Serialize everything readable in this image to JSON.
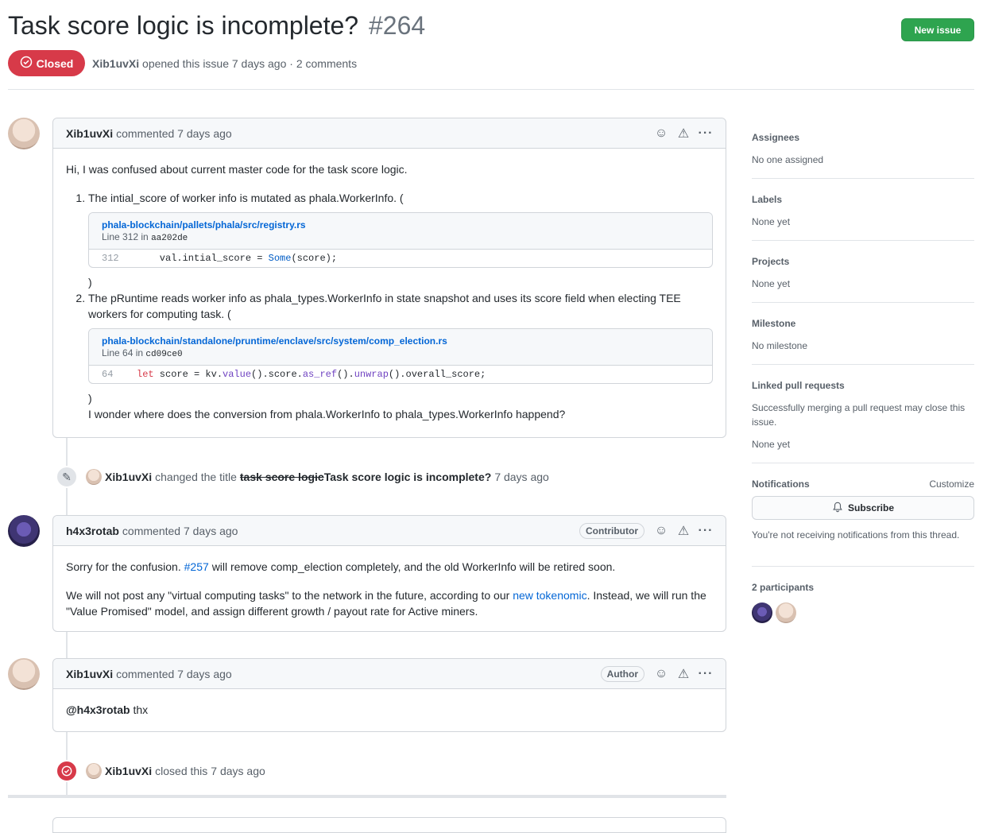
{
  "issue": {
    "title": "Task score logic is incomplete?",
    "number": "#264",
    "state": "Closed",
    "author": "Xib1uvXi",
    "opened_text": "opened this issue 7 days ago · 2 comments",
    "new_issue_label": "New issue"
  },
  "comment1": {
    "author": "Xib1uvXi",
    "time": "commented 7 days ago",
    "intro": "Hi, I was confused about current master code for the task score logic.",
    "item1_text": "The intial_score of worker info is mutated as phala.WorkerInfo. (",
    "item1_close": ")",
    "code1": {
      "path": "phala-blockchain/pallets/phala/src/registry.rs",
      "line_prefix": "Line 312 in",
      "commit": "aa202de",
      "line_no": "312",
      "code_a": "    val.intial_score = ",
      "code_fn": "Some",
      "code_b": "(score);"
    },
    "item2_text": "The pRuntime reads worker info as phala_types.WorkerInfo in state snapshot and uses its score field when electing TEE workers for computing task. (",
    "item2_close": ")",
    "code2": {
      "path": "phala-blockchain/standalone/pruntime/enclave/src/system/comp_election.rs",
      "line_prefix": "Line 64 in",
      "commit": "cd09ce0",
      "line_no": "64",
      "kw": "let",
      "code_a": " score = kv.",
      "fn1": "value",
      "code_b": "().score.",
      "fn2": "as_ref",
      "code_c": "().",
      "fn3": "unwrap",
      "code_d": "().overall_score;"
    },
    "outro": "I wonder where does the conversion from phala.WorkerInfo to phala_types.WorkerInfo happend?"
  },
  "event_rename": {
    "actor": "Xib1uvXi",
    "action": "changed the title",
    "old_title": "task score logic",
    "new_title": "Task score logic is incomplete?",
    "time": "7 days ago"
  },
  "comment2": {
    "author": "h4x3rotab",
    "time": "commented 7 days ago",
    "badge": "Contributor",
    "p1_a": "Sorry for the confusion.",
    "p1_link": "#257",
    "p1_b": "will remove comp_election completely, and the old WorkerInfo will be retired soon.",
    "p2_a": "We will not post any \"virtual computing tasks\" to the network in the future, according to our",
    "p2_link": "new tokenomic",
    "p2_b": ". Instead, we will run the \"Value Promised\" model, and assign different growth / payout rate for Active miners."
  },
  "comment3": {
    "author": "Xib1uvXi",
    "time": "commented 7 days ago",
    "badge": "Author",
    "mention": "@h4x3rotab",
    "text": "thx"
  },
  "event_close": {
    "actor": "Xib1uvXi",
    "action": "closed this",
    "time": "7 days ago"
  },
  "sidebar": {
    "assignees_title": "Assignees",
    "assignees_value": "No one assigned",
    "labels_title": "Labels",
    "labels_value": "None yet",
    "projects_title": "Projects",
    "projects_value": "None yet",
    "milestone_title": "Milestone",
    "milestone_value": "No milestone",
    "linked_title": "Linked pull requests",
    "linked_desc": "Successfully merging a pull request may close this issue.",
    "linked_value": "None yet",
    "notifications_title": "Notifications",
    "customize_label": "Customize",
    "subscribe_label": "Subscribe",
    "notifications_desc": "You're not receiving notifications from this thread.",
    "participants_title": "2 participants"
  },
  "colors": {
    "closed_red": "#d73a49",
    "new_issue_green": "#2ea44f",
    "link_blue": "#0366d6"
  }
}
